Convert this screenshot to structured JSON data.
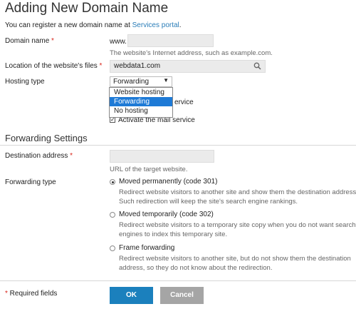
{
  "page": {
    "title": "Adding New Domain Name",
    "intro_text": "You can register a new domain name at ",
    "intro_link": "Services portal",
    "intro_end": "."
  },
  "domain": {
    "label": "Domain name",
    "prefix": "www.",
    "value": "",
    "hint": "The website's Internet address, such as example.com."
  },
  "location": {
    "label": "Location of the website's files",
    "value": "webdata1.com",
    "icon": "search-icon"
  },
  "hosting": {
    "label": "Hosting type",
    "selected": "Forwarding",
    "options": [
      "Website hosting",
      "Forwarding",
      "No hosting"
    ],
    "hidden_checkbox_tail": "ervice",
    "mail_label": "Activate the mail service"
  },
  "forwarding": {
    "section_title": "Forwarding Settings",
    "dest_label": "Destination address",
    "dest_value": "",
    "dest_hint": "URL of the target website.",
    "type_label": "Forwarding type",
    "options": [
      {
        "label": "Moved permanently (code 301)",
        "desc1": "Redirect website visitors to another site and show them the destination address.",
        "desc2": "Such redirection will keep the site's search engine rankings."
      },
      {
        "label": "Moved temporarily (code 302)",
        "desc1": "Redirect website visitors to a temporary site copy when you do not want search",
        "desc2": "engines to index this temporary site."
      },
      {
        "label": "Frame forwarding",
        "desc1": "Redirect website visitors to another site, but do not show them the destination",
        "desc2": "address, so they do not know about the redirection."
      }
    ],
    "selected_index": 0
  },
  "footer": {
    "required_marker": "*",
    "required_text": " Required fields",
    "ok_label": "OK",
    "cancel_label": "Cancel"
  },
  "colors": {
    "accent": "#1b80bd",
    "required": "#d9261c",
    "link": "#2a7db8",
    "dropdown_highlight": "#1e7ad6"
  }
}
